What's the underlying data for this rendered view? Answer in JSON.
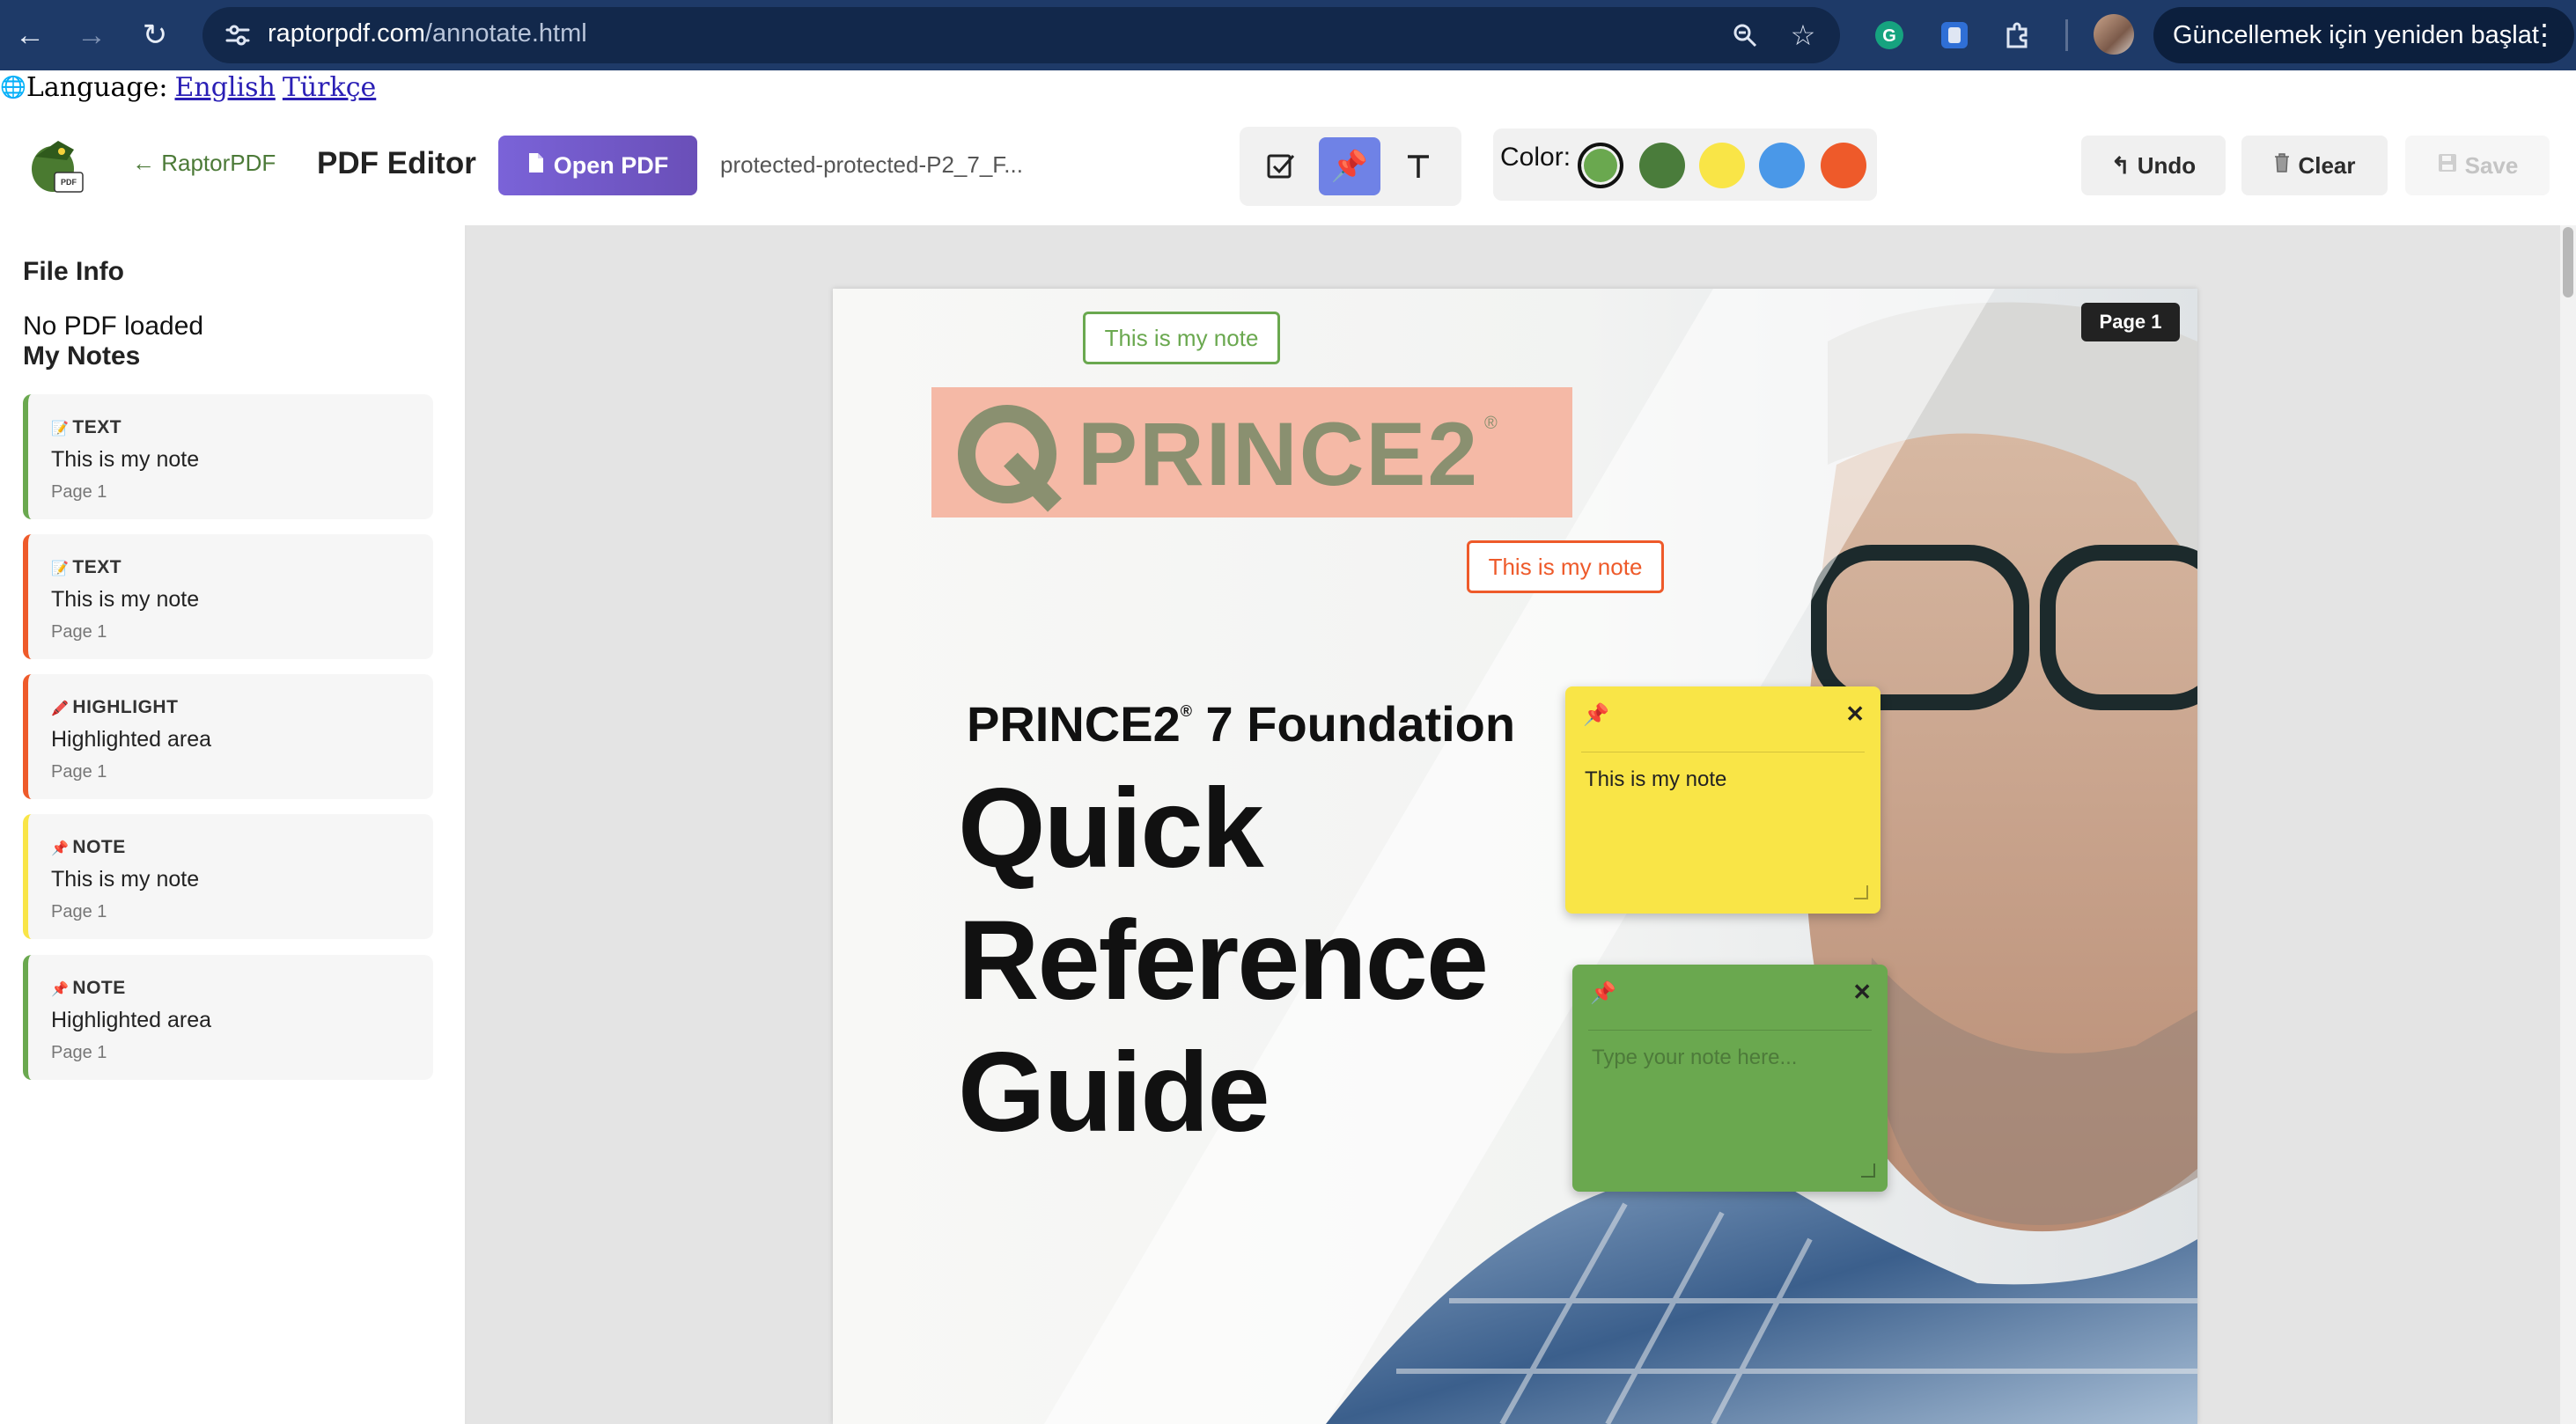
{
  "browser": {
    "url_host": "raptorpdf.com",
    "url_path": "/annotate.html",
    "update_button": "Güncellemek için yeniden başlat",
    "icons": [
      "back-icon",
      "forward-icon",
      "reload-icon",
      "tune-icon",
      "zoom-icon",
      "star-icon",
      "grammarly-icon",
      "bitwarden-icon",
      "extensions-icon",
      "avatar",
      "more-icon"
    ]
  },
  "language": {
    "label": "Language:",
    "english": "English",
    "turkish": "Türkçe"
  },
  "header": {
    "back_link": "← RaptorPDF",
    "title": "PDF Editor",
    "open_button": "Open PDF",
    "file_name": "protected-protected-P2_7_F...",
    "color_label": "Color:",
    "colors": [
      "#6aa84f",
      "#4a7c3b",
      "#f9e547",
      "#4a98e8",
      "#ee5a2a"
    ],
    "selected_color": "#6aa84f",
    "undo": "Undo",
    "clear": "Clear",
    "save": "Save"
  },
  "sidebar": {
    "file_info_title": "File Info",
    "file_info_text": "No PDF loaded",
    "notes_title": "My Notes",
    "notes": [
      {
        "icon": "📝",
        "type": "TEXT",
        "text": "This is my note",
        "page": "Page 1",
        "color": "#6aa84f"
      },
      {
        "icon": "📝",
        "type": "TEXT",
        "text": "This is my note",
        "page": "Page 1",
        "color": "#ee5a2a"
      },
      {
        "icon": "🖍️",
        "type": "HIGHLIGHT",
        "text": "Highlighted area",
        "page": "Page 1",
        "color": "#ee5a2a"
      },
      {
        "icon": "📌",
        "type": "NOTE",
        "text": "This is my note",
        "page": "Page 1",
        "color": "#f9e547"
      },
      {
        "icon": "📌",
        "type": "NOTE",
        "text": "Highlighted area",
        "page": "Page 1",
        "color": "#6aa84f"
      }
    ]
  },
  "page": {
    "badge": "Page 1",
    "logo_text": "PRINCE2",
    "logo_reg": "®",
    "subtitle_a": "PRINCE2",
    "subtitle_reg": "®",
    "subtitle_b": " 7 Foundation",
    "title_lines": [
      "Quick",
      "Reference",
      "Guide"
    ],
    "text_annotations": [
      {
        "text": "This is my note",
        "color": "#6aa84f"
      },
      {
        "text": "This is my note",
        "color": "#ee5a2a"
      }
    ],
    "sticky_notes": [
      {
        "text": "This is my note",
        "placeholder": "",
        "color": "#f9e547"
      },
      {
        "text": "",
        "placeholder": "Type your note here...",
        "color": "#6aa84f"
      }
    ]
  }
}
